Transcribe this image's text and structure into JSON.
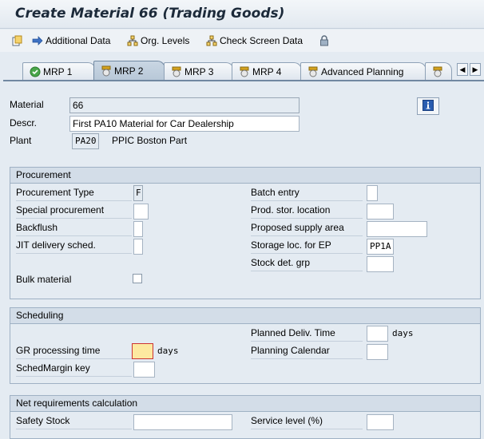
{
  "window": {
    "title": "Create Material 66 (Trading Goods)"
  },
  "toolbar": {
    "additional_data": "Additional Data",
    "org_levels": "Org. Levels",
    "check_screen_data": "Check Screen Data"
  },
  "tabs": [
    {
      "label": "MRP 1",
      "state": "done"
    },
    {
      "label": "MRP 2",
      "state": "active"
    },
    {
      "label": "MRP 3",
      "state": "open"
    },
    {
      "label": "MRP 4",
      "state": "open"
    },
    {
      "label": "Advanced Planning",
      "state": "open"
    }
  ],
  "header": {
    "material_label": "Material",
    "material_value": "66",
    "descr_label": "Descr.",
    "descr_value": "First PA10 Material for Car Dealership",
    "plant_label": "Plant",
    "plant_value": "PA20",
    "plant_name": "PPIC Boston Part"
  },
  "procurement": {
    "title": "Procurement",
    "procurement_type_label": "Procurement Type",
    "procurement_type_value": "F",
    "special_procurement_label": "Special procurement",
    "backflush_label": "Backflush",
    "jit_label": "JIT delivery sched.",
    "bulk_material_label": "Bulk material",
    "batch_entry_label": "Batch entry",
    "prod_stor_label": "Prod. stor. location",
    "proposed_supply_label": "Proposed supply area",
    "storage_loc_ep_label": "Storage loc. for EP",
    "storage_loc_ep_value": "PP1A",
    "stock_det_label": "Stock det. grp"
  },
  "scheduling": {
    "title": "Scheduling",
    "planned_deliv_label": "Planned Deliv. Time",
    "days_unit": "days",
    "gr_processing_label": "GR processing time",
    "planning_calendar_label": "Planning Calendar",
    "schedmargin_label": "SchedMargin key"
  },
  "net_req": {
    "title": "Net requirements calculation",
    "safety_stock_label": "Safety Stock",
    "service_level_label": "Service level (%)"
  },
  "colors": {
    "accent": "#7188a1",
    "required_field": "#fde9a0"
  }
}
